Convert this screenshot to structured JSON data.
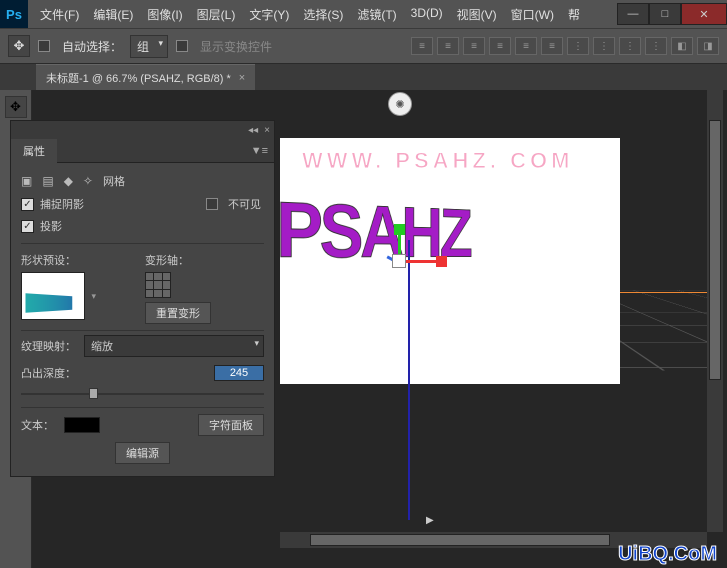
{
  "app": {
    "name": "Ps"
  },
  "menu": [
    "文件(F)",
    "编辑(E)",
    "图像(I)",
    "图层(L)",
    "文字(Y)",
    "选择(S)",
    "滤镜(T)",
    "3D(D)",
    "视图(V)",
    "窗口(W)",
    "帮"
  ],
  "options": {
    "auto_select_label": "自动选择：",
    "group_label": "组",
    "transform_label": "显示变换控件"
  },
  "tab": {
    "title": "未标题-1 @ 66.7% (PSAHZ, RGB/8) *"
  },
  "panel": {
    "title": "属性",
    "mesh_label": "网格",
    "catch_shadow": "捕捉阴影",
    "invisible": "不可见",
    "cast_shadow": "投影",
    "shape_preset": "形状预设：",
    "deform_axis": "变形轴：",
    "reset_deform": "重置变形",
    "tex_map_label": "纹理映射：",
    "tex_map_value": "缩放",
    "extrude_depth_label": "凸出深度：",
    "extrude_depth_value": "245",
    "text_label": "文本：",
    "char_panel": "字符面板",
    "edit_source": "编辑源"
  },
  "canvas": {
    "watermark": "WWW. PSAHZ. COM",
    "text3d": "PSAHZ"
  },
  "brand": {
    "text": "UiBQ.CoM"
  }
}
